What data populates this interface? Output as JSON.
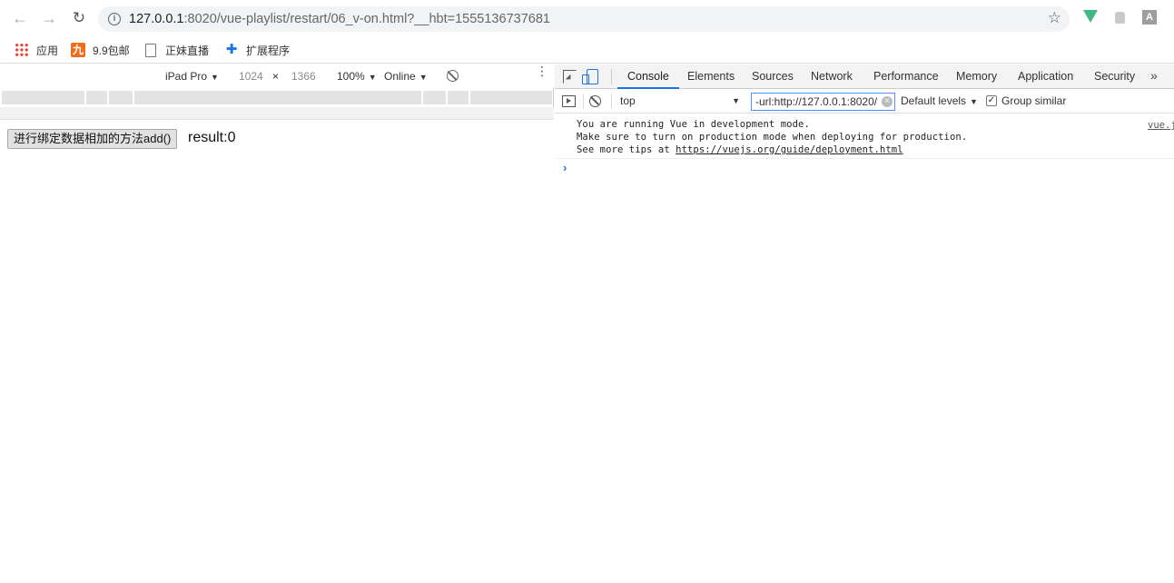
{
  "browser": {
    "url_host": "127.0.0.1",
    "url_rest": ":8020/vue-playlist/restart/06_v-on.html?__hbt=1555136737681",
    "bookmarks": [
      {
        "label": "应用",
        "icon": "apps-grid-icon"
      },
      {
        "label": "9.9包邮",
        "icon": "nine-icon",
        "icon_text": "九"
      },
      {
        "label": "正妹直播",
        "icon": "page-icon"
      },
      {
        "label": "扩展程序",
        "icon": "puzzle-icon"
      }
    ],
    "extensions": {
      "a_label": "A"
    }
  },
  "device_toolbar": {
    "device": "iPad Pro",
    "width": "1024",
    "times": "×",
    "height": "1366",
    "zoom": "100%",
    "throttling": "Online"
  },
  "page": {
    "button_label": "进行绑定数据相加的方法add()",
    "result_text": "result:0"
  },
  "devtools": {
    "tabs": [
      "Console",
      "Elements",
      "Sources",
      "Network",
      "Performance",
      "Memory",
      "Application",
      "Security"
    ],
    "active_tab": "Console",
    "more": "»",
    "context": "top",
    "filter_value": "-url:http://127.0.0.1:8020/",
    "levels": "Default levels",
    "group_similar": "Group similar",
    "group_similar_checked": true,
    "messages": {
      "line1": "You are running Vue in development mode.",
      "line2": "Make sure to turn on production mode when deploying for production.",
      "line3_prefix": "See more tips at ",
      "line3_link": "https://vuejs.org/guide/deployment.html",
      "source": "vue.js"
    },
    "prompt": "›"
  },
  "colors": {
    "accent": "#1a73e8",
    "vue": "#41b883"
  }
}
